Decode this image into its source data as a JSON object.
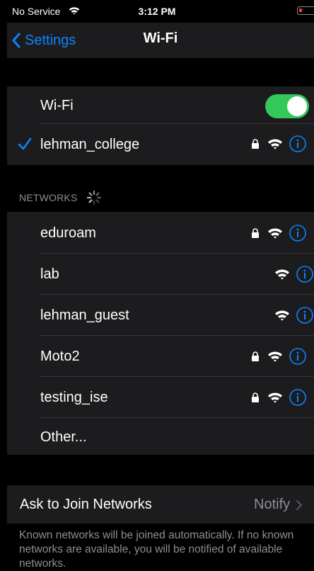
{
  "status_bar": {
    "carrier": "No Service",
    "time": "3:12 PM"
  },
  "nav": {
    "back_label": "Settings",
    "title": "Wi-Fi"
  },
  "wifi_toggle": {
    "label": "Wi-Fi",
    "on": true
  },
  "connected": {
    "name": "lehman_college",
    "secured": true
  },
  "networks_header": "NETWORKS",
  "networks": [
    {
      "name": "eduroam",
      "secured": true
    },
    {
      "name": "lab",
      "secured": false
    },
    {
      "name": "lehman_guest",
      "secured": false
    },
    {
      "name": "Moto2",
      "secured": true
    },
    {
      "name": "testing_ise",
      "secured": true
    }
  ],
  "other_label": "Other...",
  "ask_to_join": {
    "label": "Ask to Join Networks",
    "value": "Notify"
  },
  "footer_text": "Known networks will be joined automatically. If no known networks are available, you will be notified of available networks.",
  "colors": {
    "accent": "#0a84ff",
    "toggle_on": "#34c759",
    "battery_low": "#ff3b30"
  }
}
